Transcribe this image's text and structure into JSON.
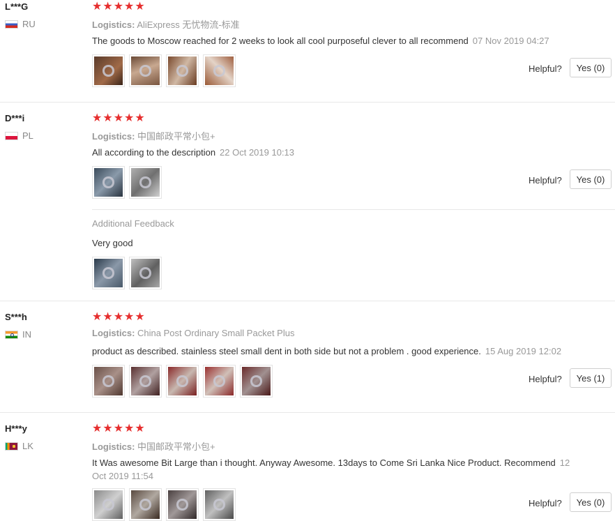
{
  "helpful_label": "Helpful?",
  "logistics_label": "Logistics:",
  "stars_text": "★★★★★",
  "additional_feedback_label": "Additional Feedback",
  "colors": {
    "star": "#e62e2e",
    "muted": "#999999",
    "text": "#333333"
  },
  "reviews": [
    {
      "user": "L***G",
      "country": "RU",
      "flag": "russia-flag-icon",
      "rating": 5,
      "logistics": "AliExpress 无忧物流-标准",
      "text": "The goods to Moscow reached for 2 weeks to look all cool purposeful clever to all recommend",
      "date": "07 Nov 2019 04:27",
      "helpful_button": "Yes (0)",
      "photo_count": 4
    },
    {
      "user": "D***i",
      "country": "PL",
      "flag": "poland-flag-icon",
      "rating": 5,
      "logistics": "中国邮政平常小包+",
      "text": "All according to the description",
      "date": "22 Oct 2019 10:13",
      "helpful_button": "Yes (0)",
      "photo_count": 2,
      "additional_feedback": {
        "text": "Very good",
        "photo_count": 2
      }
    },
    {
      "user": "S***h",
      "country": "IN",
      "flag": "india-flag-icon",
      "rating": 5,
      "logistics": "China Post Ordinary Small Packet Plus",
      "text": "product as described. stainless steel small dent in both side but not a problem . good experience.",
      "date": "15 Aug 2019 12:02",
      "helpful_button": "Yes (1)",
      "photo_count": 5
    },
    {
      "user": "H***y",
      "country": "LK",
      "flag": "sri-lanka-flag-icon",
      "rating": 5,
      "logistics": "中国邮政平常小包+",
      "text": "It Was awesome Bit Large than i thought. Anyway Awesome. 13days to Come Sri Lanka Nice Product. Recommend",
      "date_part1": "12",
      "date_part2": "Oct 2019 11:54",
      "helpful_button": "Yes (0)",
      "photo_count": 4
    }
  ]
}
